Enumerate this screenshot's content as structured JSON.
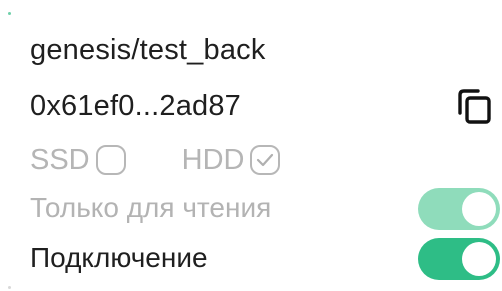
{
  "storage": {
    "name": "genesis/test_back",
    "address": "0x61ef0...2ad87"
  },
  "drive_type": {
    "ssd_label": "SSD",
    "ssd_checked": false,
    "hdd_label": "HDD",
    "hdd_checked": true
  },
  "toggles": {
    "read_only_label": "Только для чтения",
    "read_only_on": true,
    "read_only_disabled": true,
    "connection_label": "Подключение",
    "connection_on": true
  },
  "icons": {
    "copy": "copy-icon",
    "check": "check-icon"
  },
  "colors": {
    "accent": "#2ebd86",
    "accent_disabled": "#8fdcbb",
    "muted_text": "#b5b5b5",
    "text": "#1f1f1f"
  }
}
